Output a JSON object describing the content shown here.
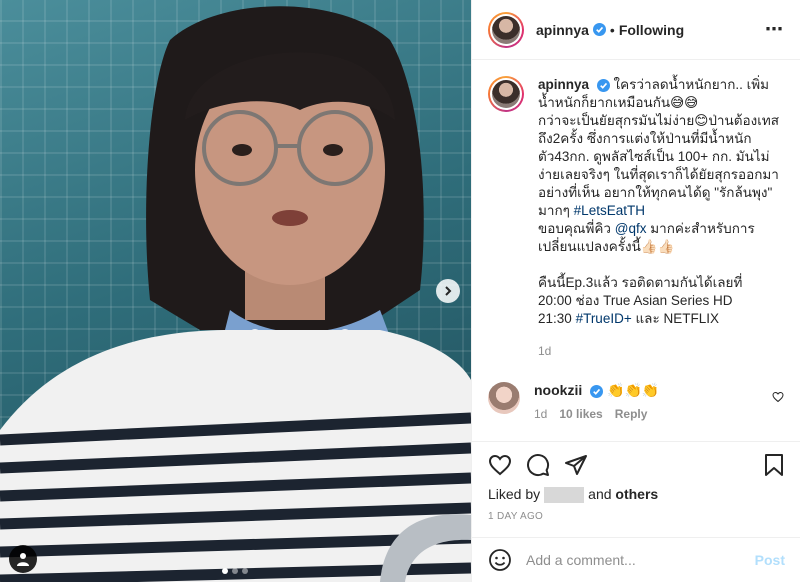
{
  "post": {
    "username": "apinnya",
    "separator": "•",
    "follow_status": "Following",
    "more_icon": "⋯",
    "media": {
      "carousel_count": 3,
      "active_index": 0
    }
  },
  "caption": {
    "username": "apinnya",
    "line1": "ใครว่าลดน้ำหนักยาก.. เพิ่มน้ำหนักก็ยากเหมือนกัน😅😅",
    "line2": "กว่าจะเป็นยัยสุกรมันไม่ง่าย😊ป่านต้องเทสถึง2ครั้ง ซึ่งการแต่งให้ป่านที่มีน้ำหนักตัว43กก. ดูพลัสไซส์เป็น 100+ กก. มันไม่ง่ายเลยจริงๆ ในที่สุดเราก็ได้ยัยสุกรออกมาอย่างที่เห็น อยากให้ทุกคนได้ดู \"รักล้นพุง\" มากๆ",
    "hashtag1": "#LetsEatTH",
    "thanks_pre": "ขอบคุณพี่คิว",
    "mention": "@qfx",
    "thanks_post": "มากค่ะสำหรับการเปลี่ยนแปลงครั้งนี้👍🏻👍🏻",
    "schedule1": "คืนนี้Ep.3แล้ว รอติดตามกันได้เลยที่",
    "schedule2": "20:00 ช่อง True Asian Series HD",
    "schedule3_time": "21:30",
    "hashtag2": "#TrueID+",
    "schedule3_post": "และ NETFLIX",
    "age": "1d"
  },
  "comment": {
    "username": "nookzii",
    "text": "👏👏👏",
    "age": "1d",
    "likes": "10 likes",
    "reply": "Reply"
  },
  "likes": {
    "prefix": "Liked by",
    "connector": "and",
    "others": "others"
  },
  "timestamp": "1 DAY AGO",
  "add_comment": {
    "placeholder": "Add a comment...",
    "post_label": "Post"
  },
  "colors": {
    "link": "#00376b",
    "verified": "#3897f0",
    "post_disabled": "#b2dffc",
    "muted": "#8e8e8e"
  }
}
